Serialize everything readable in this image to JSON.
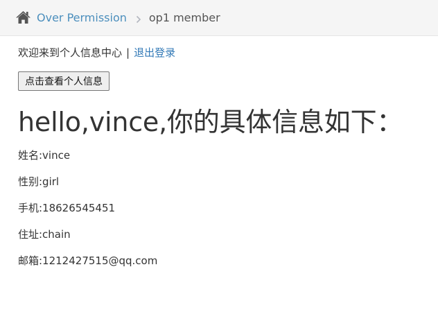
{
  "breadcrumb": {
    "home_icon": "home-icon",
    "home_label": "Over Permission",
    "separator_icon": "chevron-right-icon",
    "current": "op1 member"
  },
  "welcome": {
    "text": "欢迎来到个人信息中心",
    "divider": "|",
    "logout_label": "退出登录"
  },
  "view_button_label": "点击查看个人信息",
  "title": "hello,vince,你的具体信息如下：",
  "info": {
    "name": "姓名:vince",
    "gender": "性别:girl",
    "phone": "手机:18626545451",
    "address": "住址:chain",
    "email": "邮箱:1212427515@qq.com"
  },
  "colors": {
    "link": "#4c8fbd",
    "breadcrumb_bg": "#f5f5f5",
    "text": "#333333"
  }
}
